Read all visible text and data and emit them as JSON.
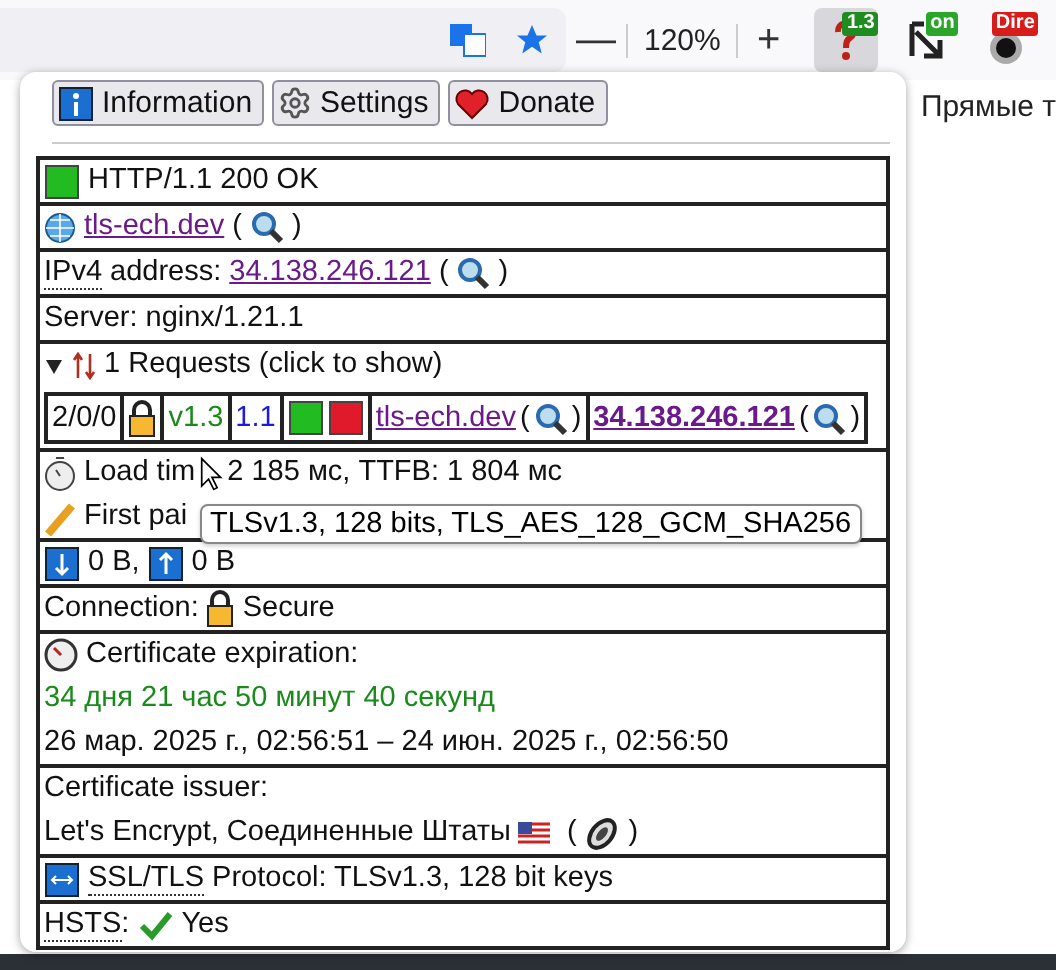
{
  "toolbar": {
    "zoom_out": "—",
    "zoom": "120%",
    "zoom_in": "+",
    "extensions": [
      {
        "badge": "1.3",
        "color": "#1e8c1e",
        "selected": true
      },
      {
        "badge": "on",
        "color": "#2aa52a",
        "selected": false
      },
      {
        "badge": "Dire",
        "color": "#d81b1b",
        "selected": false
      }
    ]
  },
  "bookmark": "Прямые т",
  "buttons": [
    {
      "kind": "info",
      "label": "Information"
    },
    {
      "kind": "settings",
      "label": "Settings"
    },
    {
      "kind": "donate",
      "label": "Donate"
    }
  ],
  "status": "HTTP/1.1 200 OK",
  "host": {
    "value": "tls-ech.dev",
    "wrap": [
      "(",
      ")"
    ]
  },
  "ip": {
    "label": "IPv4",
    "text": "address:",
    "value": "34.138.246.121",
    "wrap": [
      "(",
      ")"
    ]
  },
  "server": "Server: nginx/1.21.1",
  "requests": {
    "title": "1 Requests (click to show)",
    "expanded": true,
    "row": {
      "counts": "2/0/0",
      "tls": "v1.3",
      "http": "1.1",
      "host": "tls-ech.dev",
      "host_wrap": [
        "(",
        ")"
      ],
      "ip": "34.138.246.121",
      "ip_wrap": [
        "(",
        ")"
      ]
    }
  },
  "load_time": [
    "Load tim",
    "2 185 мс, TTFB: 1 804 мс"
  ],
  "first_paint": "First pai",
  "tooltip": "TLSv1.3, 128 bits, TLS_AES_128_GCM_SHA256",
  "traffic": {
    "down": "0 B,",
    "up": "0 B"
  },
  "connection": {
    "label": "Connection:",
    "value": "Secure"
  },
  "expiration": {
    "title": "Certificate expiration:",
    "remaining": "34 дня 21 час 50 минут 40 секунд",
    "range": "26 мар. 2025 г., 02:56:51 – 24 июн. 2025 г., 02:56:50"
  },
  "issuer": {
    "title": "Certificate issuer:",
    "value": "Let's Encrypt, Соединенные Штаты",
    "wrap": [
      "(",
      ")"
    ]
  },
  "protocol": {
    "label": "SSL/TLS",
    "text": "Protocol: TLSv1.3, 128 bit keys"
  },
  "hsts": {
    "label": "HSTS",
    "colon": ":",
    "value": "Yes",
    "enabled": true
  }
}
